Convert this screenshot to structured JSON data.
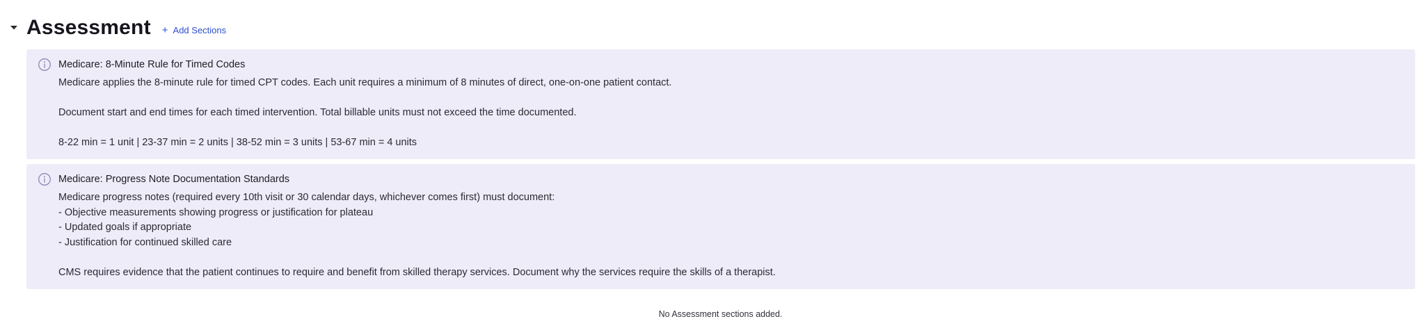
{
  "section": {
    "title": "Assessment",
    "toggle_icon": "chevron-down-icon",
    "add_button": {
      "icon": "plus-icon",
      "label": "Add Sections"
    }
  },
  "callouts": [
    {
      "icon": "info-icon",
      "title": "Medicare: 8-Minute Rule for Timed Codes",
      "lines": [
        "Medicare applies the 8-minute rule for timed CPT codes. Each unit requires a minimum of 8 minutes of direct, one-on-one patient contact.",
        "",
        "Document start and end times for each timed intervention. Total billable units must not exceed the time documented.",
        "",
        "8-22 min = 1 unit | 23-37 min = 2 units | 38-52 min = 3 units | 53-67 min = 4 units"
      ]
    },
    {
      "icon": "info-icon",
      "title": "Medicare: Progress Note Documentation Standards",
      "lines": [
        "Medicare progress notes (required every 10th visit or 30 calendar days, whichever comes first) must document:",
        "- Objective measurements showing progress or justification for plateau",
        "- Updated goals if appropriate",
        "- Justification for continued skilled care",
        "",
        "CMS requires evidence that the patient continues to require and benefit from skilled therapy services. Document why the services require the skills of a therapist."
      ]
    }
  ],
  "empty_state": "No Assessment sections added.",
  "colors": {
    "callout_background": "#efecf9",
    "info_icon": "#8e87b8",
    "link_accent": "#2f4fcf"
  }
}
